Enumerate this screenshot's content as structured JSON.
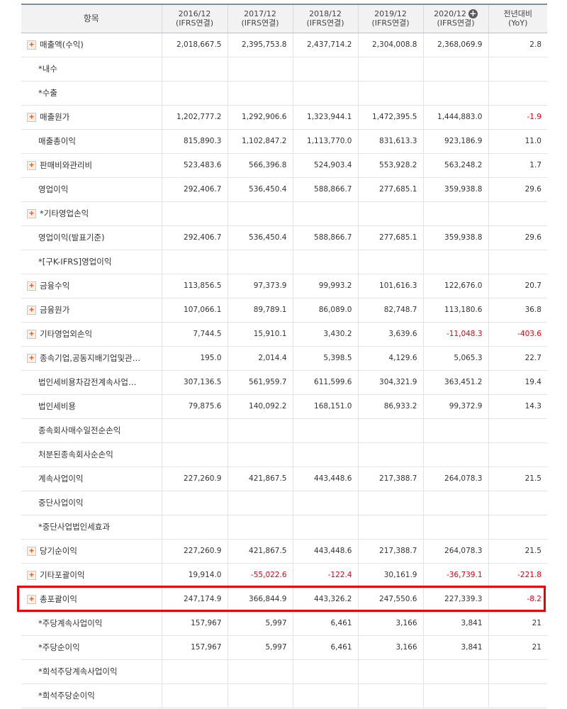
{
  "header": {
    "item_label": "항목",
    "columns": [
      {
        "line1": "2016/12",
        "line2": "(IFRS연결)"
      },
      {
        "line1": "2017/12",
        "line2": "(IFRS연결)"
      },
      {
        "line1": "2018/12",
        "line2": "(IFRS연결)"
      },
      {
        "line1": "2019/12",
        "line2": "(IFRS연결)"
      },
      {
        "line1": "2020/12",
        "line2": "(IFRS연결)",
        "expand_icon": "circle-plus-icon"
      }
    ],
    "yoy_line1": "전년대비",
    "yoy_line2": "(YoY)"
  },
  "colors": {
    "negative": "#e60012",
    "highlight": "#ee0000",
    "header_bg": "#f2f2f2"
  },
  "highlighted_row": "총포괄이익",
  "rows": [
    {
      "label": "매출액(수익)",
      "expandable": true,
      "values": [
        "2,018,667.5",
        "2,395,753.8",
        "2,437,714.2",
        "2,304,008.8",
        "2,368,069.9",
        "2.8"
      ]
    },
    {
      "label": "*내수",
      "expandable": false,
      "values": [
        "",
        "",
        "",
        "",
        "",
        ""
      ]
    },
    {
      "label": "*수출",
      "expandable": false,
      "values": [
        "",
        "",
        "",
        "",
        "",
        ""
      ]
    },
    {
      "label": "매출원가",
      "expandable": true,
      "values": [
        "1,202,777.2",
        "1,292,906.6",
        "1,323,944.1",
        "1,472,395.5",
        "1,444,883.0",
        "-1.9"
      ]
    },
    {
      "label": "매출총이익",
      "expandable": false,
      "values": [
        "815,890.3",
        "1,102,847.2",
        "1,113,770.0",
        "831,613.3",
        "923,186.9",
        "11.0"
      ]
    },
    {
      "label": "판매비와관리비",
      "expandable": true,
      "values": [
        "523,483.6",
        "566,396.8",
        "524,903.4",
        "553,928.2",
        "563,248.2",
        "1.7"
      ]
    },
    {
      "label": "영업이익",
      "expandable": false,
      "values": [
        "292,406.7",
        "536,450.4",
        "588,866.7",
        "277,685.1",
        "359,938.8",
        "29.6"
      ]
    },
    {
      "label": "*기타영업손익",
      "expandable": true,
      "values": [
        "",
        "",
        "",
        "",
        "",
        ""
      ]
    },
    {
      "label": "영업이익(발표기준)",
      "expandable": false,
      "values": [
        "292,406.7",
        "536,450.4",
        "588,866.7",
        "277,685.1",
        "359,938.8",
        "29.6"
      ]
    },
    {
      "label": "*[구K-IFRS]영업이익",
      "expandable": false,
      "values": [
        "",
        "",
        "",
        "",
        "",
        ""
      ]
    },
    {
      "label": "금융수익",
      "expandable": true,
      "values": [
        "113,856.5",
        "97,373.9",
        "99,993.2",
        "101,616.3",
        "122,676.0",
        "20.7"
      ]
    },
    {
      "label": "금융원가",
      "expandable": true,
      "values": [
        "107,066.1",
        "89,789.1",
        "86,089.0",
        "82,748.7",
        "113,180.6",
        "36.8"
      ]
    },
    {
      "label": "기타영업외손익",
      "expandable": true,
      "values": [
        "7,744.5",
        "15,910.1",
        "3,430.2",
        "3,639.6",
        "-11,048.3",
        "-403.6"
      ]
    },
    {
      "label": "종속기업,공동지배기업및관…",
      "expandable": true,
      "values": [
        "195.0",
        "2,014.4",
        "5,398.5",
        "4,129.6",
        "5,065.3",
        "22.7"
      ]
    },
    {
      "label": "법인세비용차감전계속사업…",
      "expandable": false,
      "values": [
        "307,136.5",
        "561,959.7",
        "611,599.6",
        "304,321.9",
        "363,451.2",
        "19.4"
      ]
    },
    {
      "label": "법인세비용",
      "expandable": false,
      "values": [
        "79,875.6",
        "140,092.2",
        "168,151.0",
        "86,933.2",
        "99,372.9",
        "14.3"
      ]
    },
    {
      "label": "종속회사매수일전순손익",
      "expandable": false,
      "values": [
        "",
        "",
        "",
        "",
        "",
        ""
      ]
    },
    {
      "label": "처분된종속회사순손익",
      "expandable": false,
      "values": [
        "",
        "",
        "",
        "",
        "",
        ""
      ]
    },
    {
      "label": "계속사업이익",
      "expandable": false,
      "values": [
        "227,260.9",
        "421,867.5",
        "443,448.6",
        "217,388.7",
        "264,078.3",
        "21.5"
      ]
    },
    {
      "label": "중단사업이익",
      "expandable": false,
      "values": [
        "",
        "",
        "",
        "",
        "",
        ""
      ]
    },
    {
      "label": "*중단사업법인세효과",
      "expandable": false,
      "values": [
        "",
        "",
        "",
        "",
        "",
        ""
      ]
    },
    {
      "label": "당기순이익",
      "expandable": true,
      "values": [
        "227,260.9",
        "421,867.5",
        "443,448.6",
        "217,388.7",
        "264,078.3",
        "21.5"
      ]
    },
    {
      "label": "기타포괄이익",
      "expandable": true,
      "values": [
        "19,914.0",
        "-55,022.6",
        "-122.4",
        "30,161.9",
        "-36,739.1",
        "-221.8"
      ]
    },
    {
      "label": "총포괄이익",
      "expandable": true,
      "values": [
        "247,174.9",
        "366,844.9",
        "443,326.2",
        "247,550.6",
        "227,339.3",
        "-8.2"
      ]
    },
    {
      "label": "*주당계속사업이익",
      "expandable": false,
      "values": [
        "157,967",
        "5,997",
        "6,461",
        "3,166",
        "3,841",
        "21"
      ]
    },
    {
      "label": "*주당순이익",
      "expandable": false,
      "values": [
        "157,967",
        "5,997",
        "6,461",
        "3,166",
        "3,841",
        "21"
      ]
    },
    {
      "label": "*희석주당계속사업이익",
      "expandable": false,
      "values": [
        "",
        "",
        "",
        "",
        "",
        ""
      ]
    },
    {
      "label": "*희석주당순이익",
      "expandable": false,
      "values": [
        "",
        "",
        "",
        "",
        "",
        ""
      ]
    }
  ]
}
